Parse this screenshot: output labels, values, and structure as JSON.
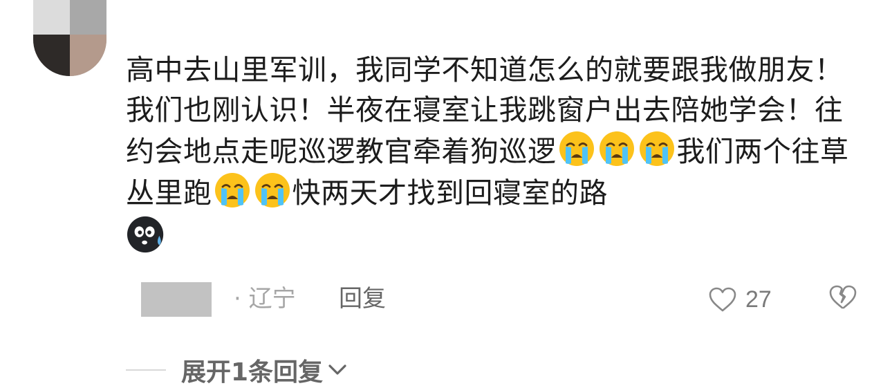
{
  "comment": {
    "text": [
      {
        "t": "text",
        "v": "高中去山里军训，我同学不知道怎么的就要跟我做朋友！我们也刚认识！半夜在寝室让我跳窗户出去陪她学会！往约会地点走呢巡逻教官牵着狗巡逻"
      },
      {
        "t": "emoji",
        "name": "loudly-crying-face-emoji"
      },
      {
        "t": "emoji",
        "name": "loudly-crying-face-emoji"
      },
      {
        "t": "emoji",
        "name": "loudly-crying-face-emoji"
      },
      {
        "t": "text",
        "v": "我们两个往草丛里跑"
      },
      {
        "t": "emoji",
        "name": "loudly-crying-face-emoji"
      },
      {
        "t": "emoji",
        "name": "loudly-crying-face-emoji"
      },
      {
        "t": "text",
        "v": "快两天才找到回寝室的路"
      },
      {
        "t": "emoji",
        "name": "sweating-dark-face-emoji"
      }
    ]
  },
  "meta": {
    "location": "· 辽宁",
    "reply_label": "回复",
    "like_count": "27",
    "like_icon": "heart-outline-icon",
    "dislike_icon": "broken-heart-icon"
  },
  "expand": {
    "label": "展开1条回复",
    "icon": "chevron-down-icon"
  },
  "colors": {
    "text": "#1c1c1c",
    "muted": "#a6a6a6",
    "action": "#666666",
    "emoji_yellow": "#fcc21b",
    "emoji_tears": "#4fc3f7",
    "redacted_block": "#c2c2c2"
  }
}
